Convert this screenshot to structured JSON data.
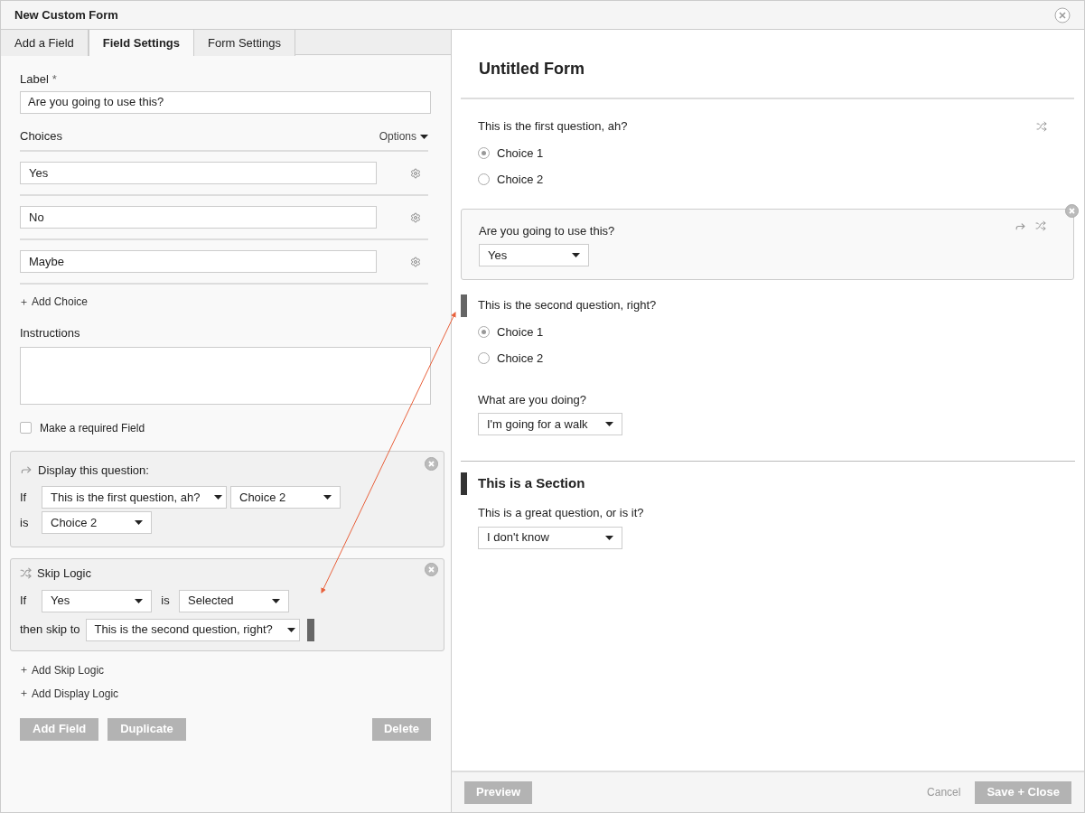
{
  "window": {
    "title": "New Custom Form"
  },
  "tabs": [
    {
      "label": "Add a Field",
      "selected": false
    },
    {
      "label": "Field Settings",
      "selected": true
    },
    {
      "label": "Form Settings",
      "selected": false
    }
  ],
  "field_settings": {
    "label_title": "Label",
    "required_mark": "*",
    "label_value": "Are you going to use this?",
    "choices_title": "Choices",
    "options_menu": "Options",
    "choices": [
      "Yes",
      "No",
      "Maybe"
    ],
    "add_choice": "Add Choice",
    "instructions_title": "Instructions",
    "required_checkbox": {
      "label": "Make a required Field",
      "checked": false
    }
  },
  "display_logic": {
    "title": "Display this question:",
    "if_label": "If",
    "question": "This is the first question, ah?",
    "choice": "Choice 2",
    "is_label": "is",
    "value": "Choice 2"
  },
  "skip_logic": {
    "title": "Skip Logic",
    "if_label": "If",
    "choice": "Yes",
    "is_label": "is",
    "state": "Selected",
    "then_label": "then skip to",
    "target": "This is the second question, right?"
  },
  "add_links": [
    "Add Skip Logic",
    "Add Display Logic"
  ],
  "buttons": [
    "Add Field",
    "Duplicate"
  ],
  "delete_button": "Delete",
  "form": {
    "title": "Untitled Form",
    "fields": [
      {
        "kind": "radio",
        "label": "This is the first question, ah?",
        "active": false,
        "skip_target": false,
        "display_logic": false,
        "skip_logic": true,
        "choices": [
          {
            "label": "Choice 1",
            "selected": true
          },
          {
            "label": "Choice 2",
            "selected": false
          }
        ]
      },
      {
        "kind": "select",
        "label": "Are you going to use this?",
        "value": "Yes",
        "active": true,
        "skip_target": false,
        "display_logic": true,
        "skip_logic": true
      },
      {
        "kind": "radio",
        "label": "This is the second question, right?",
        "active": false,
        "skip_target": true,
        "display_logic": false,
        "skip_logic": false,
        "choices": [
          {
            "label": "Choice 1",
            "selected": true
          },
          {
            "label": "Choice 2",
            "selected": false
          }
        ]
      },
      {
        "kind": "select",
        "label": "What are you doing?",
        "value": "I'm going for a walk",
        "active": false
      },
      {
        "kind": "section",
        "label": "This is a Section"
      },
      {
        "kind": "select",
        "label": "This is a great question, or is it?",
        "value": "I don't know",
        "active": false
      }
    ]
  },
  "footer": {
    "preview": "Preview",
    "cancel": "Cancel",
    "save": "Save + Close"
  }
}
